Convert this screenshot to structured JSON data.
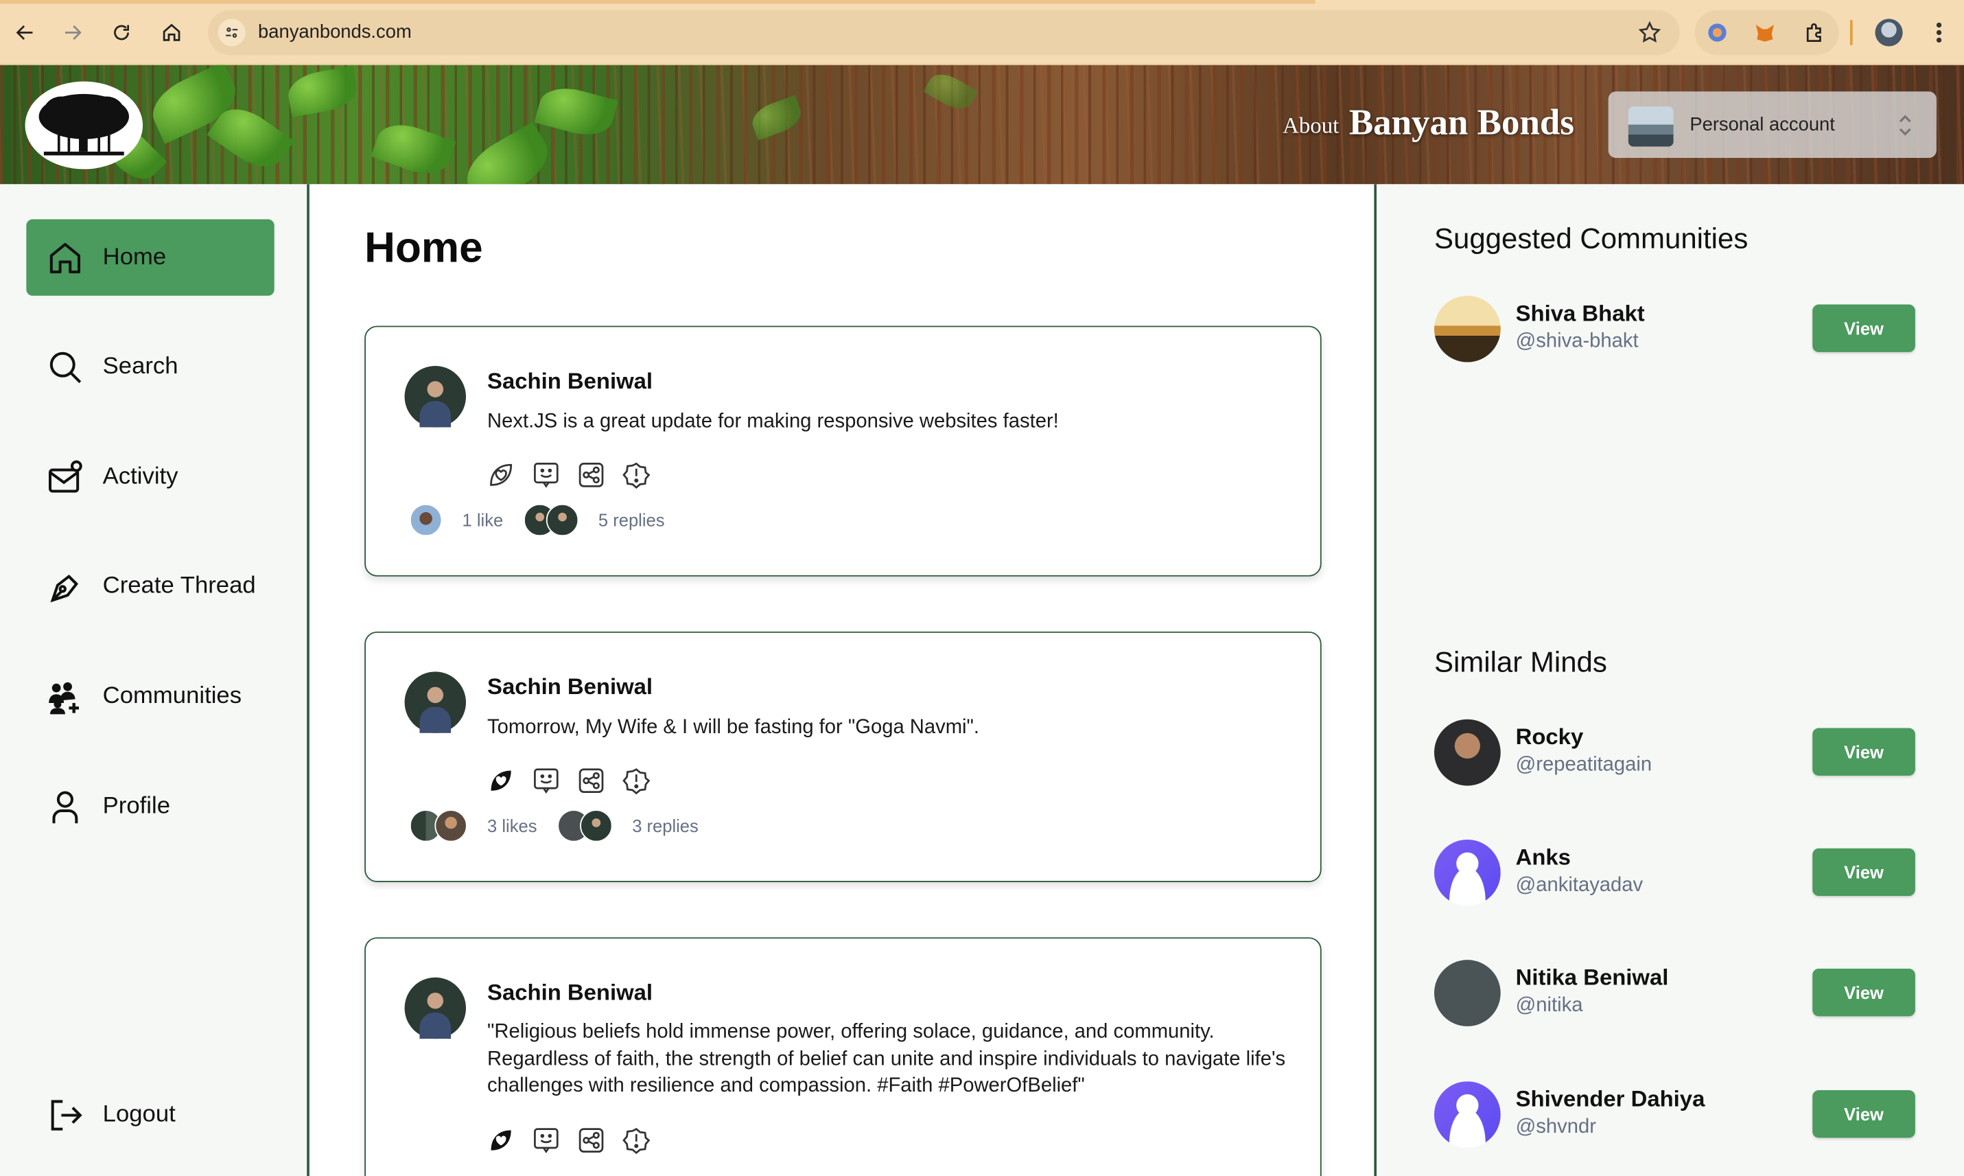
{
  "browser": {
    "url": "banyanbonds.com",
    "icons": [
      "back-icon",
      "forward-icon",
      "reload-icon",
      "home-icon",
      "site-settings-icon",
      "bookmark-star-icon",
      "extension-icon",
      "fox-extension-icon",
      "puzzle-icon",
      "profile-avatar",
      "kebab-menu-icon"
    ]
  },
  "header": {
    "about_label": "About",
    "brand": "Banyan Bonds",
    "account_label": "Personal account"
  },
  "sidebar": {
    "items": [
      {
        "label": "Home",
        "icon": "home-icon",
        "active": true
      },
      {
        "label": "Search",
        "icon": "search-icon"
      },
      {
        "label": "Activity",
        "icon": "activity-icon"
      },
      {
        "label": "Create Thread",
        "icon": "pen-icon"
      },
      {
        "label": "Communities",
        "icon": "communities-icon"
      },
      {
        "label": "Profile",
        "icon": "user-icon"
      }
    ],
    "logout_label": "Logout"
  },
  "main": {
    "title": "Home",
    "posts": [
      {
        "author": "Sachin Beniwal",
        "text": "Next.JS is a great update for making responsive websites faster!",
        "likes": "1 like",
        "replies": "5 replies",
        "liked": false
      },
      {
        "author": "Sachin Beniwal",
        "text": "Tomorrow, My Wife & I will be fasting for \"Goga Navmi\".",
        "likes": "3 likes",
        "replies": "3 replies",
        "liked": true
      },
      {
        "author": "Sachin Beniwal",
        "text": "\"Religious beliefs hold immense power, offering solace, guidance, and community. Regardless of faith, the strength of belief can unite and inspire individuals to navigate life's challenges with resilience and compassion. #Faith #PowerOfBelief\"",
        "liked": true
      }
    ]
  },
  "right": {
    "suggested_title": "Suggested Communities",
    "communities": [
      {
        "name": "Shiva Bhakt",
        "handle": "@shiva-bhakt",
        "button": "View"
      }
    ],
    "similar_title": "Similar Minds",
    "users": [
      {
        "name": "Rocky",
        "handle": "@repeatitagain",
        "button": "View"
      },
      {
        "name": "Anks",
        "handle": "@ankitayadav",
        "button": "View"
      },
      {
        "name": "Nitika Beniwal",
        "handle": "@nitika",
        "button": "View"
      },
      {
        "name": "Shivender Dahiya",
        "handle": "@shvndr",
        "button": "View"
      }
    ]
  },
  "colors": {
    "accent": "#4a9b5d",
    "border": "#2d5a3d",
    "chrome": "#f5dcb4"
  }
}
